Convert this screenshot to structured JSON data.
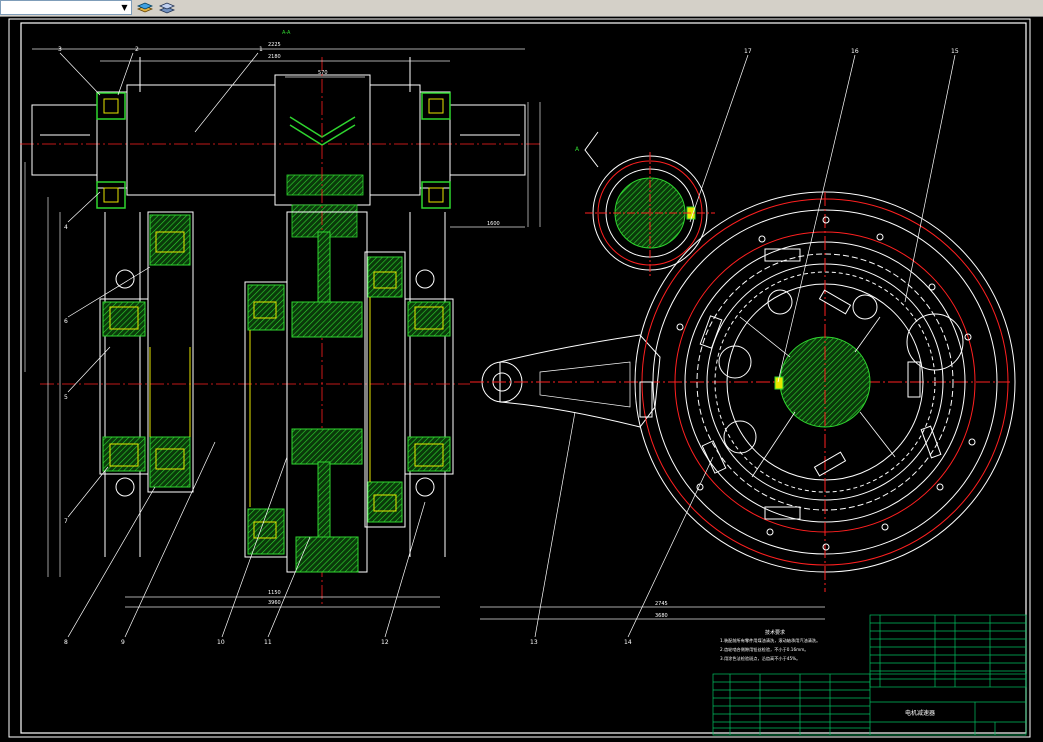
{
  "toolbar": {
    "layer_value": "",
    "buttons": [
      {
        "name": "layer-states-button",
        "icon": "layers-icon"
      },
      {
        "name": "layer-previous-button",
        "icon": "layers-stack-icon"
      }
    ]
  },
  "colors": {
    "background": "#000000",
    "line_white": "#ffffff",
    "center_red": "#ff2020",
    "hatch_green": "#2fd52f",
    "bearing_yellow": "#e6e600",
    "dim_white": "#e0e0e0",
    "table_green": "#00c060"
  },
  "drawing": {
    "dims": {
      "d1": "2225",
      "d2": "2180",
      "d3": "570",
      "d4": "Φ475",
      "d5": "Φ475",
      "d6": "Φ335",
      "d7": "Φ390",
      "d8": "Φ1050",
      "d9": "2125",
      "d10": "823",
      "d11": "1600",
      "d12": "1960",
      "d13": "8275",
      "d14": "7140",
      "d15": "1650",
      "d16": "1300",
      "d17": "Φ1200",
      "d18": "1150",
      "d19": "3960",
      "d20": "2745",
      "d21": "1830",
      "d22": "3680",
      "d23": "75",
      "d24": "520"
    },
    "balloons": [
      "3",
      "2",
      "1",
      "4",
      "6",
      "5",
      "7",
      "8",
      "9",
      "10",
      "11",
      "12",
      "13",
      "14",
      "15",
      "16",
      "17"
    ],
    "section_mark": "A-A",
    "view_label": "A"
  },
  "title_block": {
    "drawing_name": "电机减速器",
    "notes_title": "技术要求",
    "notes": [
      "1.装配前所有零件用煤油清洗，滚动轴承用汽油清洗。",
      "2.齿轮啮合侧隙用铅丝检验，不小于0.16mm。",
      "3.用涂色法检验斑点，沿齿高不小于45%。"
    ]
  }
}
